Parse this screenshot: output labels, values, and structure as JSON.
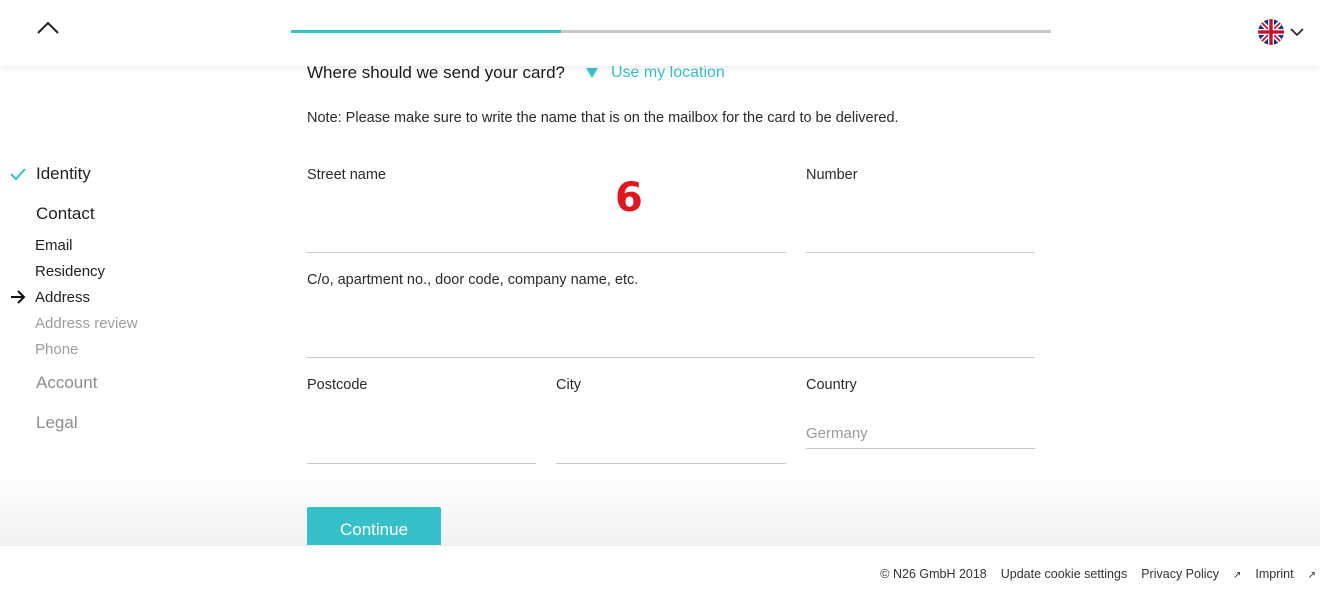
{
  "header": {
    "progress_fraction": 0.355
  },
  "sidebar": {
    "sections": [
      {
        "label": "Identity",
        "state": "done"
      },
      {
        "label": "Contact",
        "state": "active"
      },
      {
        "label": "Account",
        "state": "pending"
      },
      {
        "label": "Legal",
        "state": "pending"
      }
    ],
    "contact_steps": [
      {
        "label": "Email",
        "state": "done"
      },
      {
        "label": "Residency",
        "state": "done"
      },
      {
        "label": "Address",
        "state": "current"
      },
      {
        "label": "Address review",
        "state": "pending"
      },
      {
        "label": "Phone",
        "state": "pending"
      }
    ]
  },
  "form": {
    "question": "Where should we send your card?",
    "use_location_label": "Use my location",
    "note": "Note: Please make sure to write the name that is on the mailbox for the card to be delivered.",
    "street_label": "Street name",
    "street_value": "",
    "number_label": "Number",
    "number_value": "",
    "extra_label": "C/o, apartment no., door code, company name, etc.",
    "extra_value": "",
    "postcode_label": "Postcode",
    "postcode_value": "",
    "city_label": "City",
    "city_value": "",
    "country_label": "Country",
    "country_value": "Germany",
    "continue_label": "Continue"
  },
  "annotation_marker": "6",
  "footer": {
    "copyright": "© N26 GmbH 2018",
    "cookie_label": "Update cookie settings",
    "privacy_label": "Privacy Policy",
    "imprint_label": "Imprint"
  },
  "colors": {
    "accent": "#36c1c8",
    "marker": "#e0161e"
  },
  "icons": [
    "chevron-up-icon",
    "uk-flag-icon",
    "chevron-down-icon",
    "checkmark-icon",
    "arrow-right-icon",
    "location-arrow-icon",
    "external-link-icon"
  ]
}
